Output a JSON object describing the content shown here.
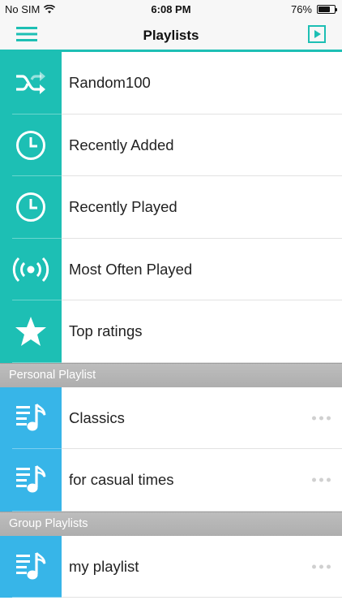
{
  "status_bar": {
    "carrier": "No SIM",
    "time": "6:08 PM",
    "battery_text": "76%",
    "battery_level": 0.76
  },
  "nav": {
    "title": "Playlists"
  },
  "colors": {
    "accent_teal": "#1dbfb4",
    "accent_blue": "#37b5e8",
    "section_gray": "#b5b5b5"
  },
  "smart_playlists": [
    {
      "label": "Random100",
      "icon": "shuffle-icon"
    },
    {
      "label": "Recently Added",
      "icon": "clock-icon"
    },
    {
      "label": "Recently Played",
      "icon": "clock-icon"
    },
    {
      "label": "Most Often Played",
      "icon": "broadcast-icon"
    },
    {
      "label": "Top ratings",
      "icon": "star-icon"
    }
  ],
  "personal_section": {
    "title": "Personal Playlist",
    "items": [
      {
        "label": "Classics",
        "icon": "playlist-note-icon"
      },
      {
        "label": "for casual times",
        "icon": "playlist-note-icon"
      }
    ]
  },
  "group_section": {
    "title": "Group Playlists",
    "items": [
      {
        "label": "my playlist",
        "icon": "playlist-note-icon"
      }
    ]
  }
}
